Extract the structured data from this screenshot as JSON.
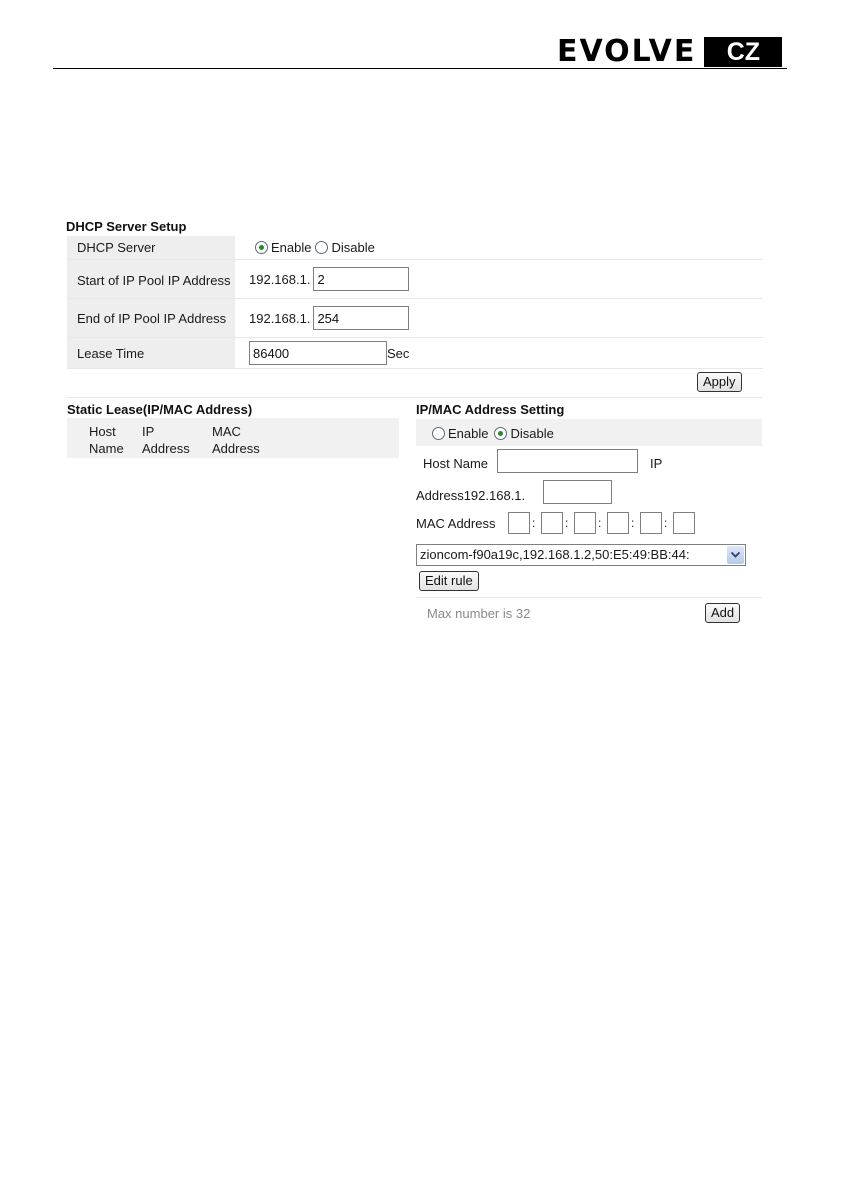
{
  "brand": {
    "name": "EVOLVE",
    "badge": "CZ"
  },
  "dhcp": {
    "title": "DHCP Server Setup",
    "server_label": "DHCP Server",
    "enable_label": "Enable",
    "disable_label": "Disable",
    "server_state": "Enable",
    "start_label": "Start of IP Pool IP Address",
    "start_prefix": "192.168.1.",
    "start_value": "2",
    "end_label": "End of IP Pool IP Address",
    "end_prefix": "192.168.1.",
    "end_value": "254",
    "lease_label": "Lease Time",
    "lease_value": "86400",
    "lease_unit": "Sec",
    "apply_label": "Apply"
  },
  "static_lease": {
    "title": "Static Lease(IP/MAC Address)",
    "columns": [
      "Host Name",
      "IP Address",
      "MAC Address"
    ]
  },
  "ipmac": {
    "title": "IP/MAC Address Setting",
    "enable_label": "Enable",
    "disable_label": "Disable",
    "state": "Disable",
    "host_name_label": "Host Name",
    "ip_label_part1": "IP",
    "ip_label_part2": "Address",
    "ip_prefix": "192.168.1.",
    "mac_label": "MAC Address",
    "mac_separator": ":",
    "selected_rule": "zioncom-f90a19c,192.168.1.2,50:E5:49:BB:44:",
    "edit_rule_label": "Edit rule",
    "max_note": "Max number is 32",
    "add_label": "Add"
  }
}
